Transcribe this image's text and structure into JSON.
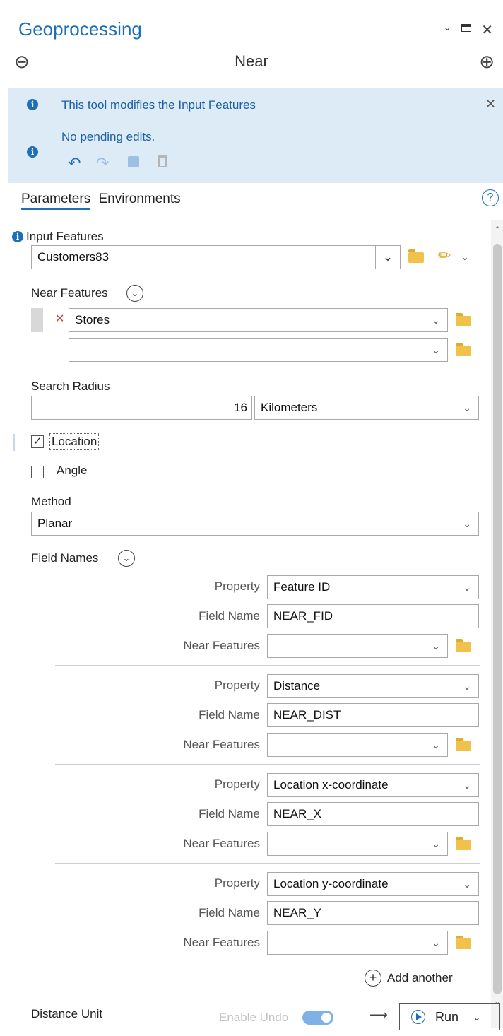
{
  "header": {
    "title": "Geoprocessing",
    "tool_name": "Near"
  },
  "banners": {
    "modifies": "This tool modifies the Input Features",
    "pending": "No pending edits."
  },
  "tabs": {
    "parameters": "Parameters",
    "environments": "Environments"
  },
  "params": {
    "input_features_label": "Input Features",
    "input_features_value": "Customers83",
    "near_features_label": "Near Features",
    "near_features_value": "Stores",
    "search_radius_label": "Search Radius",
    "search_radius_value": "16",
    "search_radius_unit": "Kilometers",
    "location_label": "Location",
    "location_checked": true,
    "angle_label": "Angle",
    "angle_checked": false,
    "method_label": "Method",
    "method_value": "Planar",
    "field_names_label": "Field Names",
    "property_label": "Property",
    "field_name_label": "Field Name",
    "near_features_row_label": "Near Features",
    "field_rows": [
      {
        "property": "Feature ID",
        "field_name": "NEAR_FID"
      },
      {
        "property": "Distance",
        "field_name": "NEAR_DIST"
      },
      {
        "property": "Location x-coordinate",
        "field_name": "NEAR_X"
      },
      {
        "property": "Location y-coordinate",
        "field_name": "NEAR_Y"
      }
    ],
    "add_another": "Add another",
    "distance_unit_label": "Distance Unit"
  },
  "footer": {
    "enable_undo": "Enable Undo",
    "run": "Run"
  },
  "colors": {
    "accent": "#1d6fb8",
    "banner": "#dcebf6",
    "folder": "#f0c24b"
  },
  "icons": [
    "back-icon",
    "add-icon",
    "info-icon",
    "close-icon",
    "undo-icon",
    "redo-icon",
    "save-icon",
    "discard-icon",
    "help-icon",
    "folder-icon",
    "pencil-icon",
    "chevron-down-icon",
    "remove-icon",
    "play-icon"
  ]
}
